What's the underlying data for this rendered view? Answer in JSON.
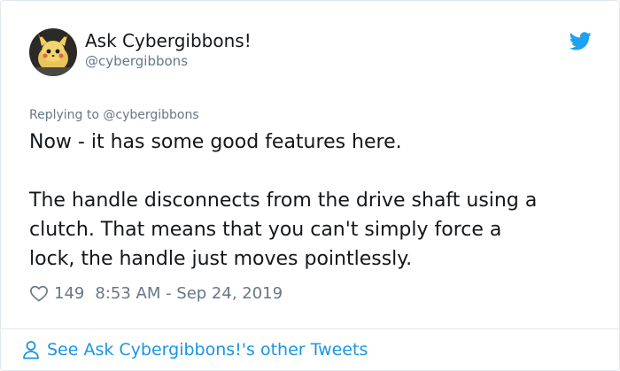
{
  "author": {
    "name": "Ask Cybergibbons!",
    "handle": "@cybergibbons",
    "avatar_icon": "avatar-image"
  },
  "reply": {
    "prefix": "Replying to ",
    "mention": "@cybergibbons"
  },
  "tweet": {
    "line1": "Now - it has some good features here.",
    "line2": "The handle disconnects from the drive shaft using a",
    "line3": "clutch. That means that you can't simply force a",
    "line4": "lock, the handle just moves pointlessly."
  },
  "meta": {
    "likes": "149",
    "timestamp": "8:53 AM - Sep 24, 2019"
  },
  "footer": {
    "label": "See Ask Cybergibbons!'s other Tweets"
  },
  "colors": {
    "brand": "#1da1f2",
    "link": "#1b95e0",
    "text": "#14171a",
    "muted": "#657786",
    "border": "#e1e8ed"
  }
}
